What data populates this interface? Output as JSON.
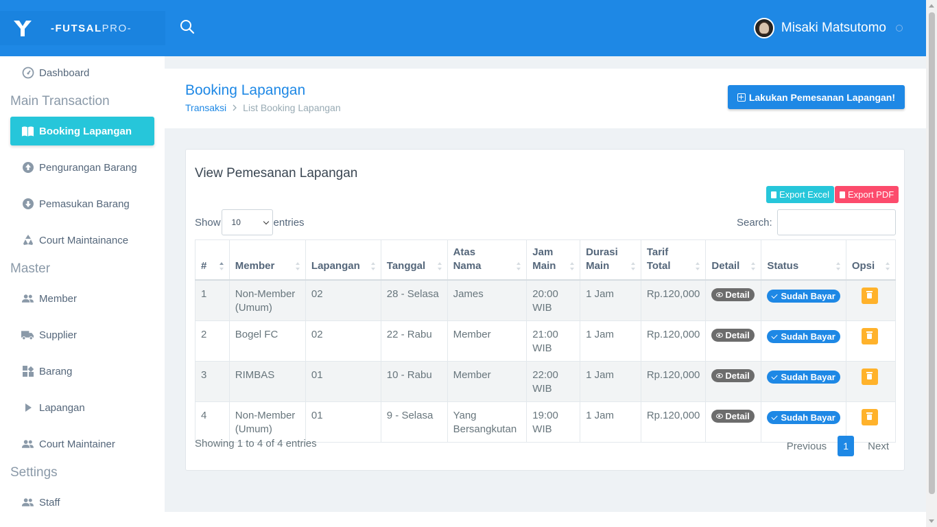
{
  "brand": {
    "prefix": "-FUTSAL",
    "suffix": "PRO-"
  },
  "user": {
    "name": "Misaki Matsutomo"
  },
  "sidebar": {
    "dashboard": "Dashboard",
    "sections": {
      "main": "Main Transaction",
      "master": "Master",
      "settings": "Settings"
    },
    "items": {
      "booking": "Booking Lapangan",
      "pengurangan": "Pengurangan Barang",
      "pemasukan": "Pemasukan Barang",
      "court_maint": "Court Maintainance",
      "member": "Member",
      "supplier": "Supplier",
      "barang": "Barang",
      "lapangan": "Lapangan",
      "court_maintainer": "Court Maintainer",
      "staff": "Staff"
    }
  },
  "header": {
    "title": "Booking Lapangan",
    "crumb_parent": "Transaksi",
    "crumb_current": "List Booking Lapangan",
    "cta": "Lakukan Pemesanan Lapangan!"
  },
  "card": {
    "title": "View Pemesanan Lapangan",
    "export_excel": "Export Excel",
    "export_pdf": "Export PDF",
    "show": "Show",
    "entries": "entries",
    "length_value": "10",
    "search_label": "Search:",
    "search_value": "",
    "columns": {
      "num": "#",
      "member": "Member",
      "lapangan": "Lapangan",
      "tanggal": "Tanggal",
      "atas_1": "Atas",
      "atas_2": "Nama",
      "jam_1": "Jam",
      "jam_2": "Main",
      "durasi_1": "Durasi",
      "durasi_2": "Main",
      "tarif_1": "Tarif",
      "tarif_2": "Total",
      "detail": "Detail",
      "status": "Status",
      "opsi": "Opsi"
    },
    "rows": [
      {
        "num": "1",
        "member": "Non-Member (Umum)",
        "lapangan": "02",
        "tanggal": "28 - Selasa",
        "atas_nama": "James",
        "jam": "20:00 WIB",
        "durasi": "1 Jam",
        "tarif": "Rp.120,000",
        "detail": "Detail",
        "status": "Sudah Bayar"
      },
      {
        "num": "2",
        "member": "Bogel FC",
        "lapangan": "02",
        "tanggal": "22 - Rabu",
        "atas_nama": "Member",
        "jam": "21:00 WIB",
        "durasi": "1 Jam",
        "tarif": "Rp.120,000",
        "detail": "Detail",
        "status": "Sudah Bayar"
      },
      {
        "num": "3",
        "member": "RIMBAS",
        "lapangan": "01",
        "tanggal": "10 - Rabu",
        "atas_nama": "Member",
        "jam": "22:00 WIB",
        "durasi": "1 Jam",
        "tarif": "Rp.120,000",
        "detail": "Detail",
        "status": "Sudah Bayar"
      },
      {
        "num": "4",
        "member": "Non-Member (Umum)",
        "lapangan": "01",
        "tanggal": "9 - Selasa",
        "atas_nama": "Yang Bersangkutan",
        "jam": "19:00 WIB",
        "durasi": "1 Jam",
        "tarif": "Rp.120,000",
        "detail": "Detail",
        "status": "Sudah Bayar"
      }
    ],
    "info": "Showing 1 to 4 of 4 entries",
    "pagination": {
      "prev": "Previous",
      "page": "1",
      "next": "Next"
    }
  },
  "colors": {
    "primary": "#1e88e5",
    "active_nav": "#26c6da",
    "excel": "#26c6da",
    "pdf": "#fc4b6c",
    "delete": "#ffb22b",
    "detail_badge": "#6c6c6c"
  },
  "icons": {
    "search": "search-icon",
    "power": "power-icon",
    "dashboard": "speedometer-icon",
    "booking": "book-open-icon",
    "pengurangan": "arrow-up-circle-icon",
    "pemasukan": "arrow-down-circle-icon",
    "court_maint": "recycle-icon",
    "member": "users-icon",
    "supplier": "truck-icon",
    "barang": "boxes-icon",
    "lapangan": "play-icon",
    "court_maintainer": "users-icon",
    "staff": "users-icon"
  }
}
